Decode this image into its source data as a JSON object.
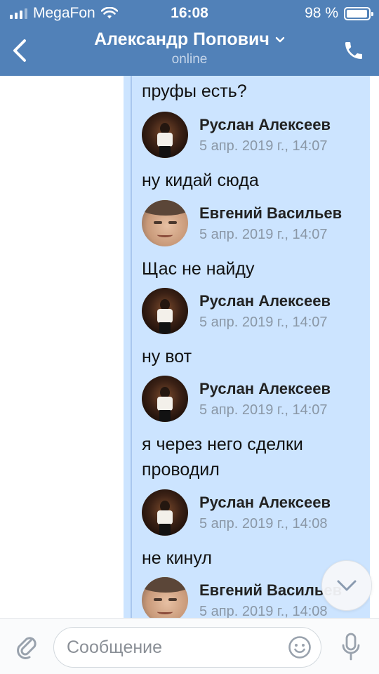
{
  "status_bar": {
    "carrier": "MegaFon",
    "time": "16:08",
    "battery": "98 %",
    "battery_level": 0.98
  },
  "header": {
    "title": "Александр Попович",
    "status": "online",
    "back_icon": "chevron-left-icon",
    "call_icon": "phone-icon",
    "chevron_icon": "chevron-down-icon"
  },
  "chat": {
    "first_text": "пруфы есть?",
    "forwarded": [
      {
        "name": "Руслан Алексеев",
        "date": "5 апр. 2019 г., 14:07",
        "text": "ну кидай сюда",
        "avatar": "dark"
      },
      {
        "name": "Евгений Васильев",
        "date": "5 апр. 2019 г., 14:07",
        "text": "Щас не найду",
        "avatar": "light"
      },
      {
        "name": "Руслан Алексеев",
        "date": "5 апр. 2019 г., 14:07",
        "text": "ну вот",
        "avatar": "dark"
      },
      {
        "name": "Руслан Алексеев",
        "date": "5 апр. 2019 г., 14:07",
        "text": "я через него сделки проводил",
        "avatar": "dark"
      },
      {
        "name": "Руслан Алексеев",
        "date": "5 апр. 2019 г., 14:08",
        "text": "не кинул",
        "avatar": "dark"
      },
      {
        "name": "Евгений Васильев",
        "date": "5 апр. 2019 г., 14:08",
        "text": "",
        "avatar": "light"
      }
    ]
  },
  "composer": {
    "placeholder": "Сообщение",
    "value": ""
  },
  "colors": {
    "header_bg": "#5181b8",
    "bubble_bg": "#cce4ff",
    "thread_line": "#a9c7ee"
  }
}
